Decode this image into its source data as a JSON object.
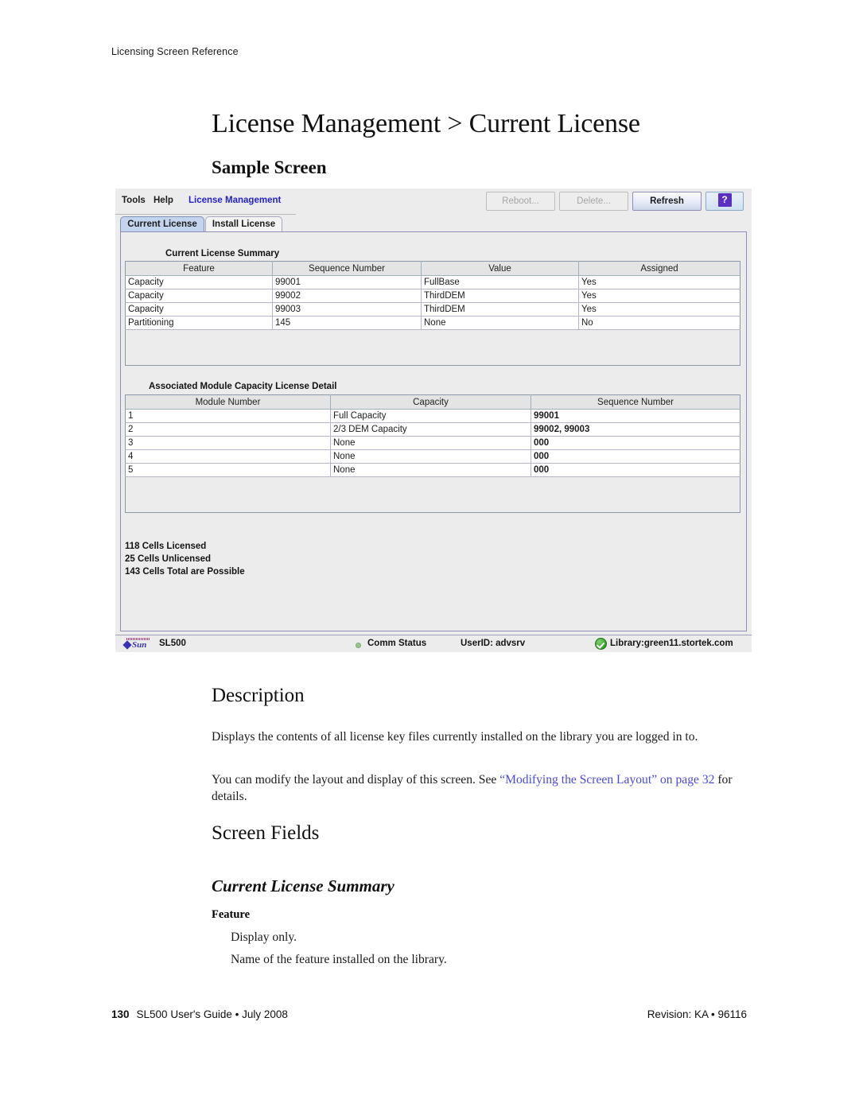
{
  "page": {
    "running_head": "Licensing Screen Reference",
    "title": "License Management > Current License",
    "footer_page_number": "130",
    "footer_left": "SL500 User's Guide • July 2008",
    "footer_right": "Revision: KA • 96116"
  },
  "sections": {
    "sample_screen_heading": "Sample Screen",
    "description_heading": "Description",
    "description_para_1": "Displays the contents of all license key files currently installed on the library you are logged in to.",
    "description_para_2_before": "You can modify the layout and display of this screen. See ",
    "description_para_2_link": "“Modifying the Screen Layout” on page 32",
    "description_para_2_after": " for details.",
    "screen_fields_heading": "Screen Fields",
    "current_license_summary_heading": "Current License Summary",
    "field_feature_name": "Feature",
    "field_feature_line_1": "Display only.",
    "field_feature_line_2": "Name of the feature installed on the library."
  },
  "app": {
    "menu": {
      "tools": "Tools",
      "help": "Help",
      "breadcrumb": "License Management"
    },
    "toolbar": {
      "reboot": "Reboot...",
      "delete": "Delete...",
      "refresh": "Refresh",
      "help_glyph": "?"
    },
    "tabs": [
      {
        "label": "Current License",
        "selected": true
      },
      {
        "label": "Install License",
        "selected": false
      }
    ],
    "summary": {
      "label": "Current License Summary",
      "columns": [
        "Feature",
        "Sequence Number",
        "Value",
        "Assigned"
      ],
      "rows": [
        [
          "Capacity",
          "99001",
          "FullBase",
          "Yes"
        ],
        [
          "Capacity",
          "99002",
          "ThirdDEM",
          "Yes"
        ],
        [
          "Capacity",
          "99003",
          "ThirdDEM",
          "Yes"
        ],
        [
          "Partitioning",
          "145",
          "None",
          "No"
        ]
      ]
    },
    "detail": {
      "label": "Associated Module Capacity License Detail",
      "columns": [
        "Module Number",
        "Capacity",
        "Sequence Number"
      ],
      "rows": [
        [
          "1",
          "Full Capacity",
          "99001"
        ],
        [
          "2",
          "2/3 DEM Capacity",
          "99002, 99003"
        ],
        [
          "3",
          "None",
          "000"
        ],
        [
          "4",
          "None",
          "000"
        ],
        [
          "5",
          "None",
          "000"
        ]
      ]
    },
    "cells": {
      "licensed": "118 Cells Licensed",
      "unlicensed": "25 Cells Unlicensed",
      "total": "143 Cells Total are Possible"
    },
    "status_bar": {
      "model": "SL500",
      "sun_wordmark": "Sun",
      "comm_status": "Comm Status",
      "user_id": "UserID: advsrv",
      "library": "Library:green11.stortek.com"
    }
  },
  "colors": {
    "link": "#4a4ad6",
    "breadcrumb": "#2323c8",
    "tab_selected_bg": "#c3d4ee",
    "help_glyph_bg": "#5b2fc4",
    "status_ok_green": "#35a02a"
  }
}
